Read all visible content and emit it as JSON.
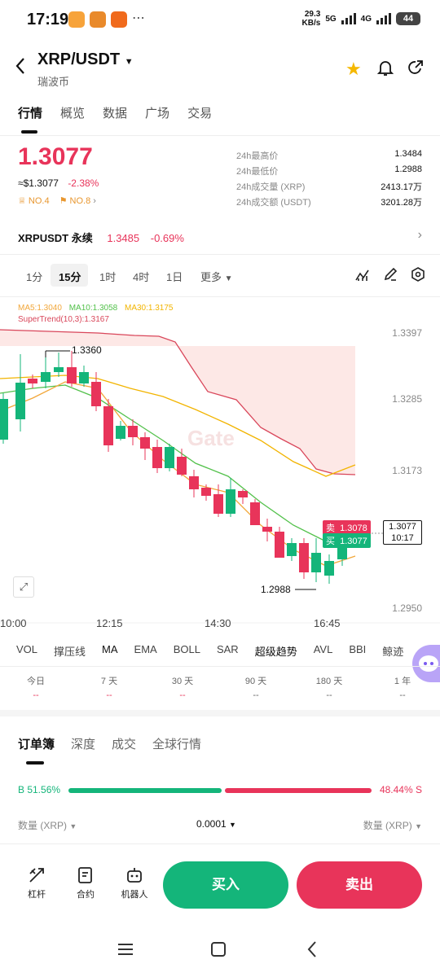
{
  "status": {
    "time": "17:19",
    "net_speed": "29.3\nKB/s",
    "net1": "5G",
    "net2": "4G",
    "battery": "44"
  },
  "header": {
    "title": "XRP/USDT",
    "subtitle": "瑞波币"
  },
  "tabs": [
    "行情",
    "概览",
    "数据",
    "广场",
    "交易"
  ],
  "ticker": {
    "price": "1.3077",
    "usd_price": "≈$1.3077",
    "change": "-2.38%",
    "rank1": "NO.4",
    "rank2": "NO.8",
    "stats": [
      {
        "label": "24h最高价",
        "value": "1.3484"
      },
      {
        "label": "24h最低价",
        "value": "1.2988"
      },
      {
        "label": "24h成交量 (XRP)",
        "value": "2413.17万"
      },
      {
        "label": "24h成交额 (USDT)",
        "value": "3201.28万"
      }
    ]
  },
  "perp": {
    "name": "XRPUSDT 永续",
    "price": "1.3485",
    "change": "-0.69%"
  },
  "timeframes": [
    "1分",
    "15分",
    "1时",
    "4时",
    "1日",
    "更多"
  ],
  "chart_data": {
    "type": "candlestick",
    "ma_legend": {
      "ma5": "MA5:1.3040",
      "ma10": "MA10:1.3058",
      "ma30": "MA30:1.3175",
      "supertrend": "SuperTrend(10,3):1.3167"
    },
    "y_ticks": [
      "1.3397",
      "1.3285",
      "1.3173",
      "1.3077",
      "1.2950"
    ],
    "x_ticks": [
      "10:00",
      "12:15",
      "14:30",
      "16:45"
    ],
    "high_label": "1.3360",
    "low_label": "1.2988",
    "sell_label": "卖",
    "sell_price": "1.3078",
    "buy_label": "买",
    "buy_price": "1.3077",
    "last_price": "1.3077",
    "countdown": "10:17",
    "watermark": "Gate",
    "colors": {
      "up": "#14b57a",
      "down": "#e8345a",
      "ma5": "#f2a73a",
      "ma10": "#53c14b",
      "ma30": "#f2b400",
      "supertrend": "#d9465a"
    }
  },
  "indicators": [
    "VOL",
    "撑压线",
    "MA",
    "EMA",
    "BOLL",
    "SAR",
    "超级趋势",
    "AVL",
    "BBI",
    "鲸迹"
  ],
  "periods": [
    {
      "label": "今日",
      "value": "--"
    },
    {
      "label": "7 天",
      "value": "--"
    },
    {
      "label": "30 天",
      "value": "--"
    },
    {
      "label": "90 天",
      "value": "--"
    },
    {
      "label": "180 天",
      "value": "--"
    },
    {
      "label": "1 年",
      "value": "--"
    }
  ],
  "orderbook": {
    "tabs": [
      "订单簿",
      "深度",
      "成交",
      "全球行情"
    ],
    "buy_ratio": "B 51.56%",
    "sell_ratio": "48.44% S",
    "buy_fraction": 0.5156,
    "col_left": "数量 (XRP)",
    "precision": "0.0001",
    "col_right": "数量 (XRP)"
  },
  "bottom": {
    "leverage": "杠杆",
    "contract": "合约",
    "bot": "机器人",
    "buy": "买入",
    "sell": "卖出"
  }
}
